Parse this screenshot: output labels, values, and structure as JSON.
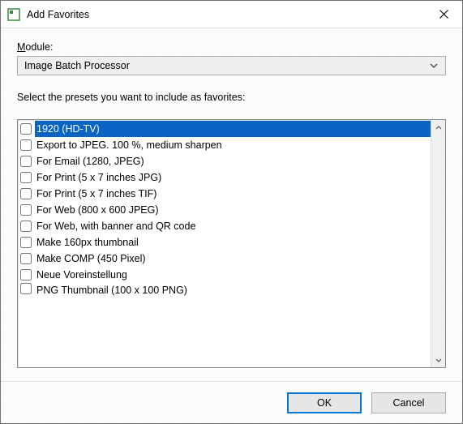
{
  "window": {
    "title": "Add Favorites"
  },
  "labels": {
    "module": "odule:",
    "module_prefix": "M",
    "instruction": "Select the presets you want to include as favorites:"
  },
  "module_combo": {
    "value": "Image Batch Processor"
  },
  "presets": [
    {
      "label": "1920 (HD-TV)",
      "checked": false,
      "selected": true
    },
    {
      "label": "Export to JPEG. 100 %, medium sharpen",
      "checked": false,
      "selected": false
    },
    {
      "label": "For Email (1280, JPEG)",
      "checked": false,
      "selected": false
    },
    {
      "label": "For Print (5 x 7 inches JPG)",
      "checked": false,
      "selected": false
    },
    {
      "label": "For Print (5 x 7 inches TIF)",
      "checked": false,
      "selected": false
    },
    {
      "label": "For Web (800 x 600 JPEG)",
      "checked": false,
      "selected": false
    },
    {
      "label": "For Web, with banner and QR code",
      "checked": false,
      "selected": false
    },
    {
      "label": "Make 160px thumbnail",
      "checked": false,
      "selected": false
    },
    {
      "label": "Make COMP (450 Pixel)",
      "checked": false,
      "selected": false
    },
    {
      "label": "Neue Voreinstellung",
      "checked": false,
      "selected": false
    },
    {
      "label": "PNG Thumbnail (100 x 100 PNG)",
      "checked": false,
      "selected": false
    }
  ],
  "buttons": {
    "ok": "OK",
    "cancel": "Cancel"
  }
}
